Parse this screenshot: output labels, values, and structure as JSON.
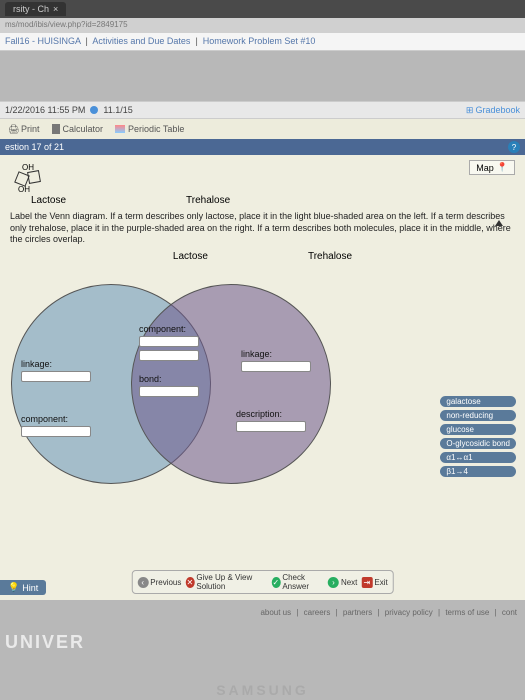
{
  "tab": {
    "title": "rsity - Ch",
    "close": "×"
  },
  "url": "ms/mod/ibis/view.php?id=2849175",
  "breadcrumb": {
    "course": "Fall16 - HUISINGA",
    "sep": "|",
    "activities": "Activities and Due Dates",
    "hw": "Homework Problem Set #10"
  },
  "status": {
    "datetime": "1/22/2016 11:55 PM",
    "counter": "11.1/15",
    "gradebook": "Gradebook"
  },
  "toolbar": {
    "print": "Print",
    "calc": "Calculator",
    "periodic": "Periodic Table"
  },
  "question": {
    "label": "estion 17 of 21"
  },
  "map_btn": "Map",
  "molecules": {
    "left_oh_top": "OH",
    "left_oh_bot": "OH",
    "lactose": "Lactose",
    "trehalose": "Trehalose"
  },
  "instructions": "Label the Venn diagram. If a term describes only lactose, place it in the light blue-shaded area on the left. If a term describes only trehalose, place it in the purple-shaded area on the right. If a term describes both molecules, place it in the middle, where the circles overlap.",
  "venn": {
    "left_label": "Lactose",
    "right_label": "Trehalose",
    "slots": {
      "left_linkage": "linkage:",
      "left_component": "component:",
      "mid_component": "component:",
      "mid_bond": "bond:",
      "right_linkage": "linkage:",
      "right_description": "description:"
    }
  },
  "terms": [
    "galactose",
    "non-reducing",
    "glucose",
    "O-glycosidic bond",
    "α1↔α1",
    "β1→4"
  ],
  "nav": {
    "previous": "Previous",
    "giveup": "Give Up & View Solution",
    "check": "Check Answer",
    "next": "Next",
    "exit": "Exit"
  },
  "hint": "Hint",
  "footer": {
    "about": "about us",
    "careers": "careers",
    "partners": "partners",
    "privacy": "privacy policy",
    "terms": "terms of use",
    "cont": "cont"
  },
  "brand": "UNIVER",
  "device": "SAMSUNG"
}
